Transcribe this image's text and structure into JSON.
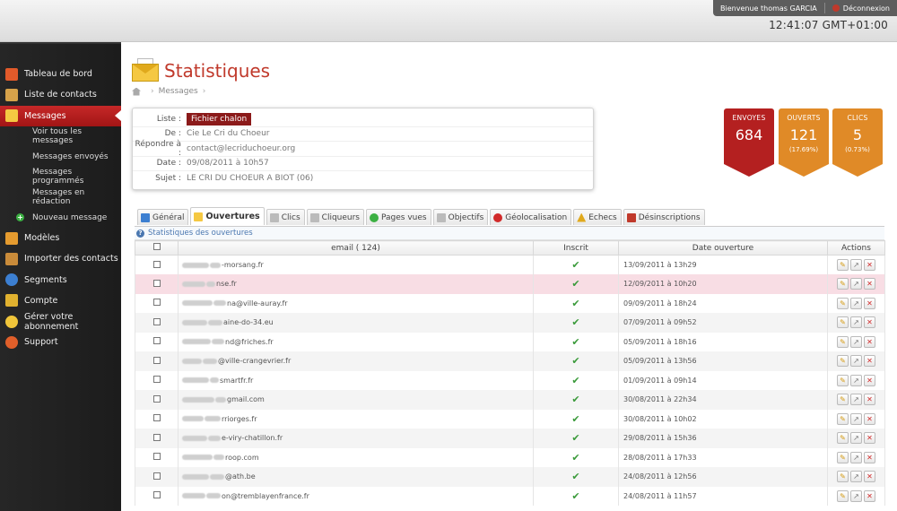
{
  "topbar": {
    "welcome": "Bienvenue thomas GARCIA",
    "logout": "Déconnexion",
    "clock": "12:41:07 GMT+01:00"
  },
  "sidebar": {
    "items": [
      {
        "label": "Tableau de bord",
        "icon": "home-icon",
        "color": "#e25a2a"
      },
      {
        "label": "Liste de contacts",
        "icon": "contacts-book-icon",
        "color": "#d6a24a"
      },
      {
        "label": "Messages",
        "icon": "envelope-icon",
        "color": "#f5c842",
        "active": true
      },
      {
        "label": "Modèles",
        "icon": "templates-icon",
        "color": "#e59b2f"
      },
      {
        "label": "Importer des contacts",
        "icon": "import-icon",
        "color": "#c98b3a"
      },
      {
        "label": "Segments",
        "icon": "globe-icon",
        "color": "#3c7fd1"
      },
      {
        "label": "Compte",
        "icon": "key-icon",
        "color": "#e0b12f"
      },
      {
        "label": "Gérer votre abonnement",
        "icon": "coins-icon",
        "color": "#f0c53a"
      },
      {
        "label": "Support",
        "icon": "support-icon",
        "color": "#e05f2a"
      }
    ],
    "subitems": [
      "Voir tous les messages",
      "Messages envoyés",
      "Messages programmés",
      "Messages en rédaction"
    ],
    "new_message": "Nouveau message"
  },
  "page": {
    "title": "Statistiques",
    "breadcrumb": "Messages"
  },
  "info": {
    "liste_label": "Liste :",
    "liste_value": "Fichier chalon",
    "de_label": "De :",
    "de_value": "Cie Le Cri du Choeur",
    "reply_label": "Répondre à :",
    "reply_value": "contact@lecriduchoeur.org",
    "date_label": "Date :",
    "date_value": "09/08/2011 à 10h57",
    "sujet_label": "Sujet :",
    "sujet_value": "LE CRI DU CHOEUR A BIOT (06)"
  },
  "stats": {
    "envoyes": {
      "label": "ENVOYES",
      "value": "684"
    },
    "ouverts": {
      "label": "OUVERTS",
      "value": "121",
      "pct": "(17.69%)"
    },
    "clics": {
      "label": "CLICS",
      "value": "5",
      "pct": "(0.73%)"
    }
  },
  "tabs": [
    {
      "label": "Général",
      "icon": "bar-chart-icon",
      "color": "#3c7fd1"
    },
    {
      "label": "Ouvertures",
      "icon": "envelope-open-icon",
      "color": "#f5c842",
      "active": true
    },
    {
      "label": "Clics",
      "icon": "cursor-icon",
      "color": "#999999"
    },
    {
      "label": "Cliqueurs",
      "icon": "cursor-icon",
      "color": "#999999"
    },
    {
      "label": "Pages vues",
      "icon": "globe-icon",
      "color": "#3cb043"
    },
    {
      "label": "Objectifs",
      "icon": "flag-icon",
      "color": "#999999"
    },
    {
      "label": "Géolocalisation",
      "icon": "pin-icon",
      "color": "#d12a2a"
    },
    {
      "label": "Echecs",
      "icon": "warning-icon",
      "color": "#e0a91c"
    },
    {
      "label": "Désinscriptions",
      "icon": "unsubscribe-icon",
      "color": "#c0392b"
    }
  ],
  "panel": {
    "subtitle": "Statistiques des ouvertures",
    "columns": {
      "email": "email ( 124)",
      "inscrit": "Inscrit",
      "date": "Date ouverture",
      "actions": "Actions"
    },
    "rows": [
      {
        "email": "-morsang.fr",
        "date": "13/09/2011 à 13h29"
      },
      {
        "email": "nse.fr",
        "date": "12/09/2011 à 10h20"
      },
      {
        "email": "na@ville-auray.fr",
        "date": "09/09/2011 à 18h24"
      },
      {
        "email": "aine-do-34.eu",
        "date": "07/09/2011 à 09h52"
      },
      {
        "email": "nd@friches.fr",
        "date": "05/09/2011 à 18h16"
      },
      {
        "email": "@ville-crangevrier.fr",
        "date": "05/09/2011 à 13h56"
      },
      {
        "email": "smartfr.fr",
        "date": "01/09/2011 à 09h14"
      },
      {
        "email": "gmail.com",
        "date": "30/08/2011 à 22h34"
      },
      {
        "email": "rriorges.fr",
        "date": "30/08/2011 à 10h02"
      },
      {
        "email": "e-viry-chatillon.fr",
        "date": "29/08/2011 à 15h36"
      },
      {
        "email": "roop.com",
        "date": "28/08/2011 à 17h33"
      },
      {
        "email": "@ath.be",
        "date": "24/08/2011 à 12h56"
      },
      {
        "email": "on@tremblayenfrance.fr",
        "date": "24/08/2011 à 11h57"
      }
    ]
  }
}
